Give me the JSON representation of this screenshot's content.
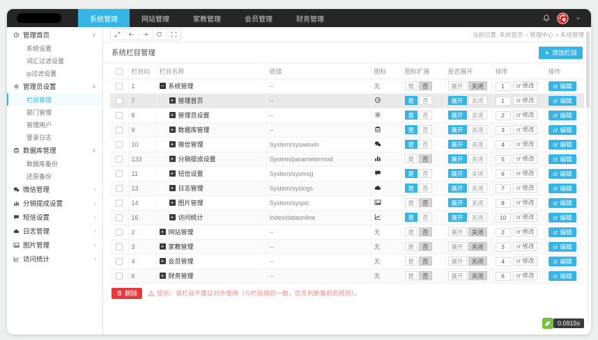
{
  "colors": {
    "accent": "#35b5e5",
    "navbar_bg": "#262626",
    "danger": "#e4393c",
    "hint_text": "#e98b8b",
    "timer_green": "#7ac143",
    "row_highlight": "#e9e9e9"
  },
  "navbar": {
    "menu": [
      {
        "label": "系统管理",
        "active": true
      },
      {
        "label": "网站管理",
        "active": false
      },
      {
        "label": "家教管理",
        "active": false
      },
      {
        "label": "会员管理",
        "active": false
      },
      {
        "label": "财务管理",
        "active": false
      }
    ]
  },
  "sidebar": {
    "groups": [
      {
        "icon": "dashboard",
        "label": "管理首页",
        "expanded": true,
        "children": [
          {
            "label": "系统设置"
          },
          {
            "label": "词汇过滤设置"
          },
          {
            "label": "ip过滤设置"
          }
        ]
      },
      {
        "icon": "gear",
        "label": "管理员设置",
        "expanded": true,
        "children": [
          {
            "label": "栏目管理",
            "active": true
          },
          {
            "label": "部门管理"
          },
          {
            "label": "管理用户"
          },
          {
            "label": "登录日志"
          }
        ]
      },
      {
        "icon": "database",
        "label": "数据库管理",
        "expanded": true,
        "children": [
          {
            "label": "数据库备份"
          },
          {
            "label": "还原备份"
          }
        ]
      },
      {
        "icon": "wechat",
        "label": "微信管理",
        "expanded": false
      },
      {
        "icon": "bar-chart",
        "label": "分销提成设置",
        "expanded": false
      },
      {
        "icon": "comment",
        "label": "短信设置",
        "expanded": false
      },
      {
        "icon": "cloud",
        "label": "日志管理",
        "expanded": false
      },
      {
        "icon": "image",
        "label": "图片管理",
        "expanded": false
      },
      {
        "icon": "line-chart",
        "label": "访问统计",
        "expanded": false
      }
    ]
  },
  "toolbar": {
    "breadcrumb": "当前位置: 系统首页 > 管理中心 > 系统管理"
  },
  "panel": {
    "title": "系统栏目管理",
    "add_label": "添加栏目"
  },
  "table": {
    "headers": [
      "栏目ID",
      "栏目名称",
      "链接",
      "图标",
      "图标扩展",
      "是否展开",
      "排序",
      "操作"
    ],
    "labels": {
      "yes": "是",
      "no": "否",
      "open": "展开",
      "close": "关闭",
      "modify": "修改",
      "edit": "编辑",
      "none": "无"
    },
    "rows": [
      {
        "id": "1",
        "name": "系统管理",
        "level": 0,
        "tree": "minus",
        "link": "--",
        "icon": "none",
        "icon_ext": "否",
        "expand": "关闭",
        "sort": "1",
        "highlight": false
      },
      {
        "id": "7",
        "name": "管理首页",
        "level": 1,
        "tree": "plus",
        "link": "--",
        "icon": "dashboard",
        "icon_ext": "是",
        "expand": "展开",
        "sort": "1",
        "highlight": true
      },
      {
        "id": "8",
        "name": "管理员设置",
        "level": 1,
        "tree": "plus",
        "link": "--",
        "icon": "gear",
        "icon_ext": "是",
        "expand": "展开",
        "sort": "2",
        "highlight": false
      },
      {
        "id": "9",
        "name": "数据库管理",
        "level": 1,
        "tree": "plus",
        "link": "--",
        "icon": "database",
        "icon_ext": "是",
        "expand": "展开",
        "sort": "3",
        "highlight": false
      },
      {
        "id": "10",
        "name": "微信管理",
        "level": 1,
        "tree": "plus",
        "link": "System/sysweixin",
        "icon": "wechat",
        "icon_ext": "是",
        "expand": "展开",
        "sort": "4",
        "highlight": false
      },
      {
        "id": "133",
        "name": "分销提成设置",
        "level": 1,
        "tree": "plus",
        "link": "System/parametermod",
        "icon": "bar-chart",
        "icon_ext": "否",
        "expand": "展开",
        "sort": "5",
        "highlight": false
      },
      {
        "id": "11",
        "name": "短信设置",
        "level": 1,
        "tree": "plus",
        "link": "System/sysmsg",
        "icon": "comment",
        "icon_ext": "是",
        "expand": "展开",
        "sort": "6",
        "highlight": false
      },
      {
        "id": "13",
        "name": "日志管理",
        "level": 1,
        "tree": "plus",
        "link": "System/syslogs",
        "icon": "cloud",
        "icon_ext": "是",
        "expand": "展开",
        "sort": "7",
        "highlight": false
      },
      {
        "id": "14",
        "name": "图片管理",
        "level": 1,
        "tree": "plus",
        "link": "System/syspic",
        "icon": "image",
        "icon_ext": "否",
        "expand": "展开",
        "sort": "8",
        "highlight": false
      },
      {
        "id": "16",
        "name": "访问统计",
        "level": 1,
        "tree": "plus",
        "link": "Index/dataonline",
        "icon": "line-chart",
        "icon_ext": "是",
        "expand": "展开",
        "sort": "10",
        "highlight": false
      },
      {
        "id": "2",
        "name": "网站管理",
        "level": 0,
        "tree": "plus",
        "link": "--",
        "icon": "none",
        "icon_ext": "否",
        "expand": "关闭",
        "sort": "2",
        "highlight": false
      },
      {
        "id": "3",
        "name": "家教管理",
        "level": 0,
        "tree": "plus",
        "link": "--",
        "icon": "none",
        "icon_ext": "否",
        "expand": "关闭",
        "sort": "3",
        "highlight": false
      },
      {
        "id": "4",
        "name": "会员管理",
        "level": 0,
        "tree": "plus",
        "link": "--",
        "icon": "none",
        "icon_ext": "否",
        "expand": "关闭",
        "sort": "4",
        "highlight": false
      },
      {
        "id": "6",
        "name": "财务管理",
        "level": 0,
        "tree": "plus",
        "link": "--",
        "icon": "none",
        "icon_ext": "否",
        "expand": "关闭",
        "sort": "6",
        "highlight": false
      }
    ]
  },
  "footer": {
    "delete_label": "删除",
    "hint": "提示：该栏目不建议对外使用（与栏目规则一致，优先判断靠前的规则）。"
  },
  "status": {
    "elapsed": "0.0915s"
  }
}
